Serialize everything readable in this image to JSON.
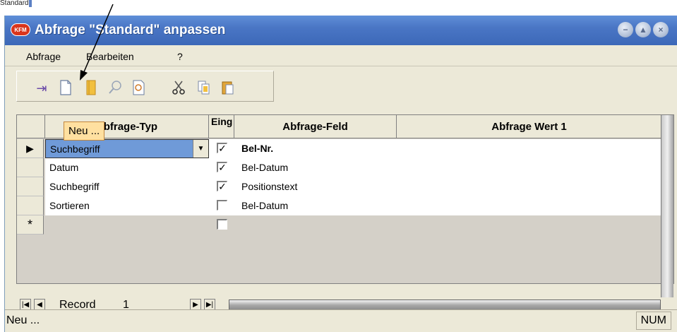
{
  "background_window": {
    "fragment_text": "Standard",
    "fragment_highlight": ""
  },
  "window": {
    "app_icon_text": "KFM",
    "title": "Abfrage \"Standard\" anpassen",
    "controls": {
      "minimize": "−",
      "maximize": "▲",
      "close": "×"
    }
  },
  "menu": {
    "items": [
      {
        "label": "Abfrage"
      },
      {
        "label": "Bearbeiten"
      },
      {
        "label": "?"
      }
    ]
  },
  "toolbar": {
    "icons": [
      "exit-icon",
      "new-document-icon",
      "book-icon",
      "search-icon",
      "preview-icon",
      "cut-icon",
      "copy-icon",
      "paste-icon"
    ]
  },
  "grid": {
    "columns": {
      "typ": "Abfrage-Typ",
      "eing": "Eing",
      "feld": "Abfrage-Feld",
      "wert1": "Abfrage Wert 1"
    },
    "rows": [
      {
        "selector": "▶",
        "typ": "Suchbegriff",
        "eing": "✓",
        "feld": "Bel-Nr."
      },
      {
        "selector": "",
        "typ": "Datum",
        "eing": "✓",
        "feld": "Bel-Datum"
      },
      {
        "selector": "",
        "typ": "Suchbegriff",
        "eing": "✓",
        "feld": "Positionstext"
      },
      {
        "selector": "",
        "typ": "Sortieren",
        "eing": "",
        "feld": "Bel-Datum"
      },
      {
        "selector": "*",
        "typ": "",
        "eing": "",
        "feld": ""
      }
    ]
  },
  "navigation": {
    "first": "|◀",
    "prev": "◀",
    "record_label": "Record",
    "record_number": "1",
    "next": "▶",
    "last": "▶|"
  },
  "tooltip": {
    "text": "Neu ..."
  },
  "statusbar": {
    "text": "Neu ...",
    "indicator": "NUM"
  },
  "colors": {
    "title_bar": "#4a76c5",
    "tooltip_bg": "#ffe0a0",
    "selected_cell": "#6f9ad8",
    "chrome": "#ece9d8"
  }
}
